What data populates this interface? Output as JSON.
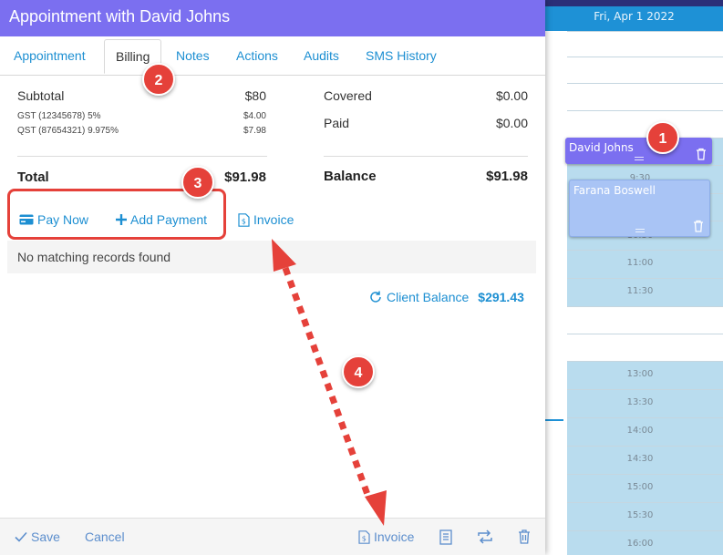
{
  "window": {
    "title": "Appointment with David Johns"
  },
  "tabs": [
    {
      "label": "Appointment"
    },
    {
      "label": "Billing"
    },
    {
      "label": "Notes"
    },
    {
      "label": "Actions"
    },
    {
      "label": "Audits"
    },
    {
      "label": "SMS History"
    }
  ],
  "billing": {
    "subtotal_label": "Subtotal",
    "subtotal_value": "$80",
    "gst_label": "GST (12345678) 5%",
    "gst_value": "$4.00",
    "qst_label": "QST (87654321) 9.975%",
    "qst_value": "$7.98",
    "total_label": "Total",
    "total_value": "$91.98",
    "covered_label": "Covered",
    "covered_value": "$0.00",
    "paid_label": "Paid",
    "paid_value": "$0.00",
    "balance_label": "Balance",
    "balance_value": "$91.98"
  },
  "actions": {
    "pay_now": "Pay Now",
    "add_payment": "Add Payment",
    "invoice": "Invoice"
  },
  "table": {
    "empty_message": "No matching records found"
  },
  "client_balance": {
    "label": "Client Balance",
    "value": "$291.43"
  },
  "footer": {
    "save": "Save",
    "cancel": "Cancel",
    "invoice": "Invoice"
  },
  "calendar": {
    "date": "Fri, Apr 1 2022",
    "times": [
      "9:30",
      "10:30",
      "11:00",
      "11:30",
      "13:00",
      "13:30",
      "14:00",
      "14:30",
      "15:00",
      "15:30",
      "16:00"
    ],
    "appointments": [
      {
        "name": "David Johns"
      },
      {
        "name": "Farana Boswell"
      }
    ]
  },
  "annotations": [
    "1",
    "2",
    "3",
    "4"
  ],
  "colors": {
    "header_purple": "#7b6ff0",
    "link_blue": "#1d8fd2",
    "annotation_red": "#e5413a",
    "calendar_blue": "#1e91d6",
    "slot_blue": "#b9dcee"
  }
}
